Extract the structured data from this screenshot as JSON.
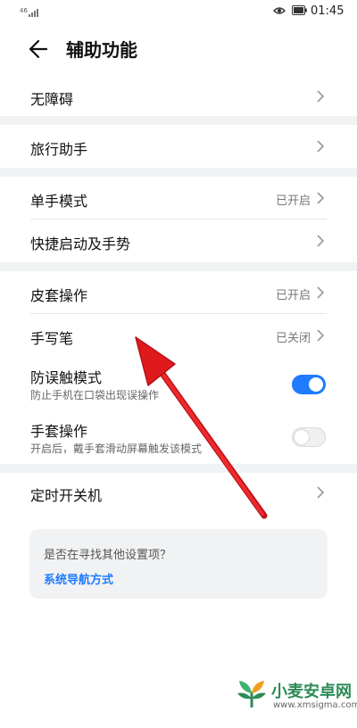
{
  "status_bar": {
    "time": "01:45"
  },
  "header": {
    "title": "辅助功能"
  },
  "items": {
    "accessibility": {
      "label": "无障碍"
    },
    "travel": {
      "label": "旅行助手"
    },
    "one_hand": {
      "label": "单手模式",
      "value": "已开启"
    },
    "shortcuts": {
      "label": "快捷启动及手势"
    },
    "cover": {
      "label": "皮套操作",
      "value": "已开启"
    },
    "pen": {
      "label": "手写笔",
      "value": "已关闭"
    },
    "accidental": {
      "label": "防误触模式",
      "desc": "防止手机在口袋出现误操作",
      "toggle_on": true
    },
    "glove": {
      "label": "手套操作",
      "desc": "开启后，戴手套滑动屏幕触发该模式",
      "toggle_on": false
    },
    "timer": {
      "label": "定时开关机"
    }
  },
  "suggestion": {
    "question": "是否在寻找其他设置项？",
    "link": "系统导航方式"
  },
  "watermark": {
    "name": "小麦安卓网",
    "url": "www.xmsigma.com"
  },
  "colors": {
    "accent": "#1f7bff",
    "arrow": "#e0191c",
    "separator": "#f1f2f3"
  }
}
